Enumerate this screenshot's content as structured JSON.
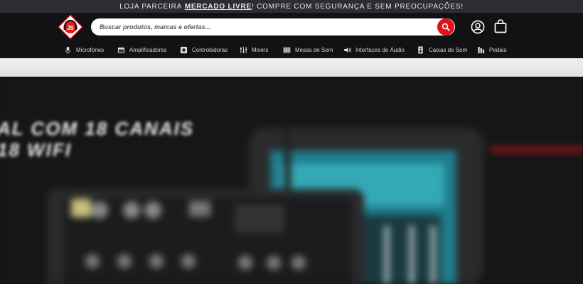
{
  "topbar": {
    "prefix": "LOJA PARCEIRA ",
    "highlight": "MERCADO LIVRE",
    "suffix": "! COMPRE COM SEGURANÇA E SEM PREOCUPAÇÕES!"
  },
  "header": {
    "search_placeholder": "Buscar produtos, marcas e ofertas...",
    "accent_color": "#e3121a",
    "logo_text": "JS"
  },
  "nav": {
    "items": [
      {
        "label": "Microfones",
        "icon": "microphone-icon"
      },
      {
        "label": "Amplificadores",
        "icon": "amplifier-icon"
      },
      {
        "label": "Controladoras",
        "icon": "controller-icon"
      },
      {
        "label": "Mixers",
        "icon": "mixer-sliders-icon"
      },
      {
        "label": "Mesas de Som",
        "icon": "mixing-desk-icon"
      },
      {
        "label": "Interfaces de Áudio",
        "icon": "speaker-volume-icon"
      },
      {
        "label": "Caixas de Som",
        "icon": "speaker-box-icon"
      },
      {
        "label": "Pedais",
        "icon": "pedal-icon"
      }
    ]
  },
  "hero": {
    "title_line1": "AL COM 18 CANAIS",
    "title_line2": "18 WIFI"
  }
}
